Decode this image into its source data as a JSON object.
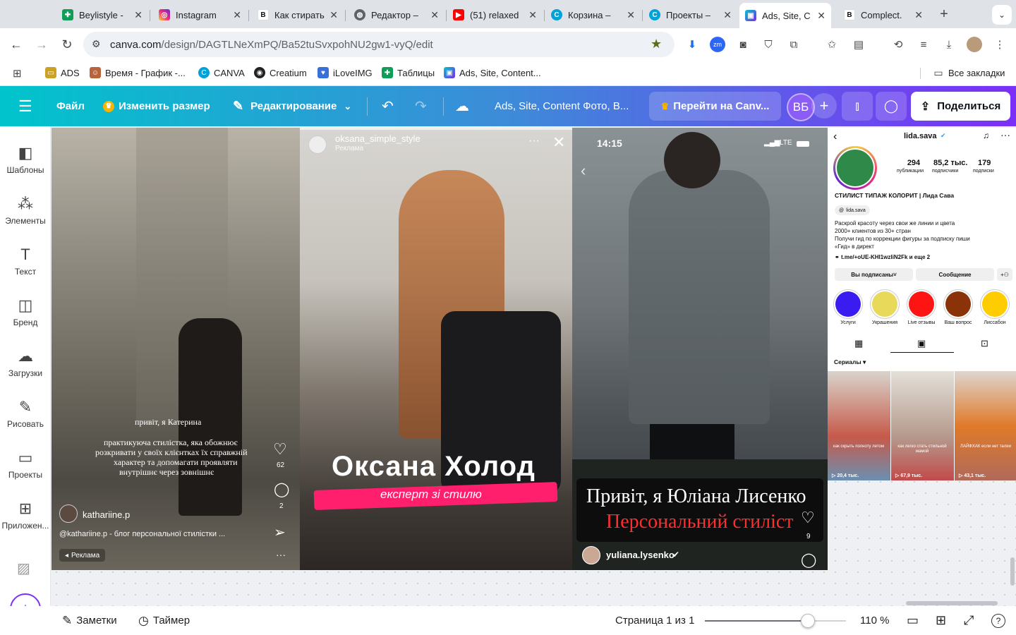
{
  "tabs": [
    {
      "label": "Beylistyle -",
      "icon": "sheets-icon",
      "color": "#0f9d58"
    },
    {
      "label": "Instagram",
      "icon": "instagram-icon",
      "color": "#d6249f"
    },
    {
      "label": "Как стирать",
      "icon": "bold-b-icon",
      "color": "#111111"
    },
    {
      "label": "Редактор –",
      "icon": "globe-icon",
      "color": "#5f6368"
    },
    {
      "label": "(51) relaxed",
      "icon": "youtube-icon",
      "color": "#ff0000"
    },
    {
      "label": "Корзина –",
      "icon": "canva-icon",
      "color": "#00a3d7"
    },
    {
      "label": "Проекты –",
      "icon": "canva-icon",
      "color": "#00a3d7"
    },
    {
      "label": "Ads, Site, C",
      "icon": "canva-design-icon",
      "color": "#7d2ae8"
    },
    {
      "label": "Complect.",
      "icon": "bold-b-icon",
      "color": "#111111"
    }
  ],
  "address": {
    "host": "canva.com",
    "path": "/design/DAGTLNeXmPQ/Ba52tuSvxpohNU2gw1-vyQ/edit"
  },
  "bookmarks": [
    {
      "label": "ADS",
      "icon": "folder-icon"
    },
    {
      "label": "Время - График -...",
      "icon": "person-icon"
    },
    {
      "label": "CANVA",
      "icon": "canva-icon"
    },
    {
      "label": "Creatium",
      "icon": "creatium-icon"
    },
    {
      "label": "iLoveIMG",
      "icon": "heart-icon"
    },
    {
      "label": "Таблицы",
      "icon": "sheets-icon"
    },
    {
      "label": "Ads, Site, Content...",
      "icon": "canva-design-icon"
    }
  ],
  "bookmarks_all": "Все закладки",
  "canva_header": {
    "file": "Файл",
    "resize": "Изменить размер",
    "editing": "Редактирование",
    "title": "Ads, Site, Content Фото, В...",
    "premium": "Перейти на Canv...",
    "avatar": "ВБ",
    "share": "Поделиться"
  },
  "sidebar": [
    {
      "label": "Шаблоны",
      "icon": "templates-icon"
    },
    {
      "label": "Элементы",
      "icon": "elements-icon"
    },
    {
      "label": "Текст",
      "icon": "text-icon"
    },
    {
      "label": "Бренд",
      "icon": "brand-icon"
    },
    {
      "label": "Загрузки",
      "icon": "upload-icon"
    },
    {
      "label": "Рисовать",
      "icon": "draw-icon"
    },
    {
      "label": "Проекты",
      "icon": "folder-icon"
    },
    {
      "label": "Приложен...",
      "icon": "apps-icon"
    }
  ],
  "panel1": {
    "caption_line1": "привіт, я Катерина",
    "caption_line2": "практикуюча стилістка, яка обожнює",
    "caption_line3": "розкривати у своїх клієнтках їх справжній",
    "caption_line4": "характер та допомагати проявляти",
    "caption_line5": "внутрішнє через зовнішнє",
    "likes": "62",
    "comments": "2",
    "username": "kathariine.p",
    "description": "@kathariine.p - блог персональної стилістки ...",
    "ad_label": "Реклама"
  },
  "panel2": {
    "username": "oksana_simple_style",
    "ad_label": "Реклама",
    "name": "Оксана Холод",
    "subtitle": "експерт зі стилю"
  },
  "panel3": {
    "time": "14:15",
    "network": "LTE",
    "line1": "Привіт, я Юліана Лисенко",
    "line2": "Персональний стиліст",
    "likes": "9",
    "username": "yuliana.lysenko"
  },
  "panel4": {
    "username": "lida.sava",
    "posts": "294",
    "posts_label": "публикации",
    "followers": "85,2 тыс.",
    "followers_label": "подписчики",
    "following": "179",
    "following_label": "подписки",
    "bio_title": "СТИЛИСТ ТИПАЖ КОЛОРИТ | Лида Сава",
    "threads": "lida.sava",
    "bio1": "Раскрой красоту через свои же линии и цвета",
    "bio2": "2000+ клиентов из 30+ стран",
    "bio3": "Получи гид по коррекции фигуры за подписку пиши",
    "bio4": "«Гид» в директ",
    "link": "t.me/+oUE-KHI1wzliN2Fk и еще 2",
    "btn_following": "Вы подписаны",
    "btn_message": "Сообщение",
    "highlights": [
      {
        "label": "Услуги",
        "color": "#3a1cf0"
      },
      {
        "label": "Украшения",
        "color": "#e8d95a"
      },
      {
        "label": "Live отзывы",
        "color": "#ff1414"
      },
      {
        "label": "Ваш вопрос",
        "color": "#8b3308"
      },
      {
        "label": "Лиссабон",
        "color": "#ffcc00"
      }
    ],
    "series_label": "Сериалы",
    "thumbs": [
      {
        "caption": "как скрыть полноту летом",
        "views": "20,4 тыс."
      },
      {
        "caption": "как легко стать стильной мамой",
        "views": "67,9 тыс."
      },
      {
        "caption": "ЛАЙФХАК если нет талии",
        "views": "43,1 тыс."
      }
    ]
  },
  "bottom": {
    "notes": "Заметки",
    "timer": "Таймер",
    "page": "Страница 1 из 1",
    "zoom": "110 %",
    "zoom_fraction": 0.73
  }
}
